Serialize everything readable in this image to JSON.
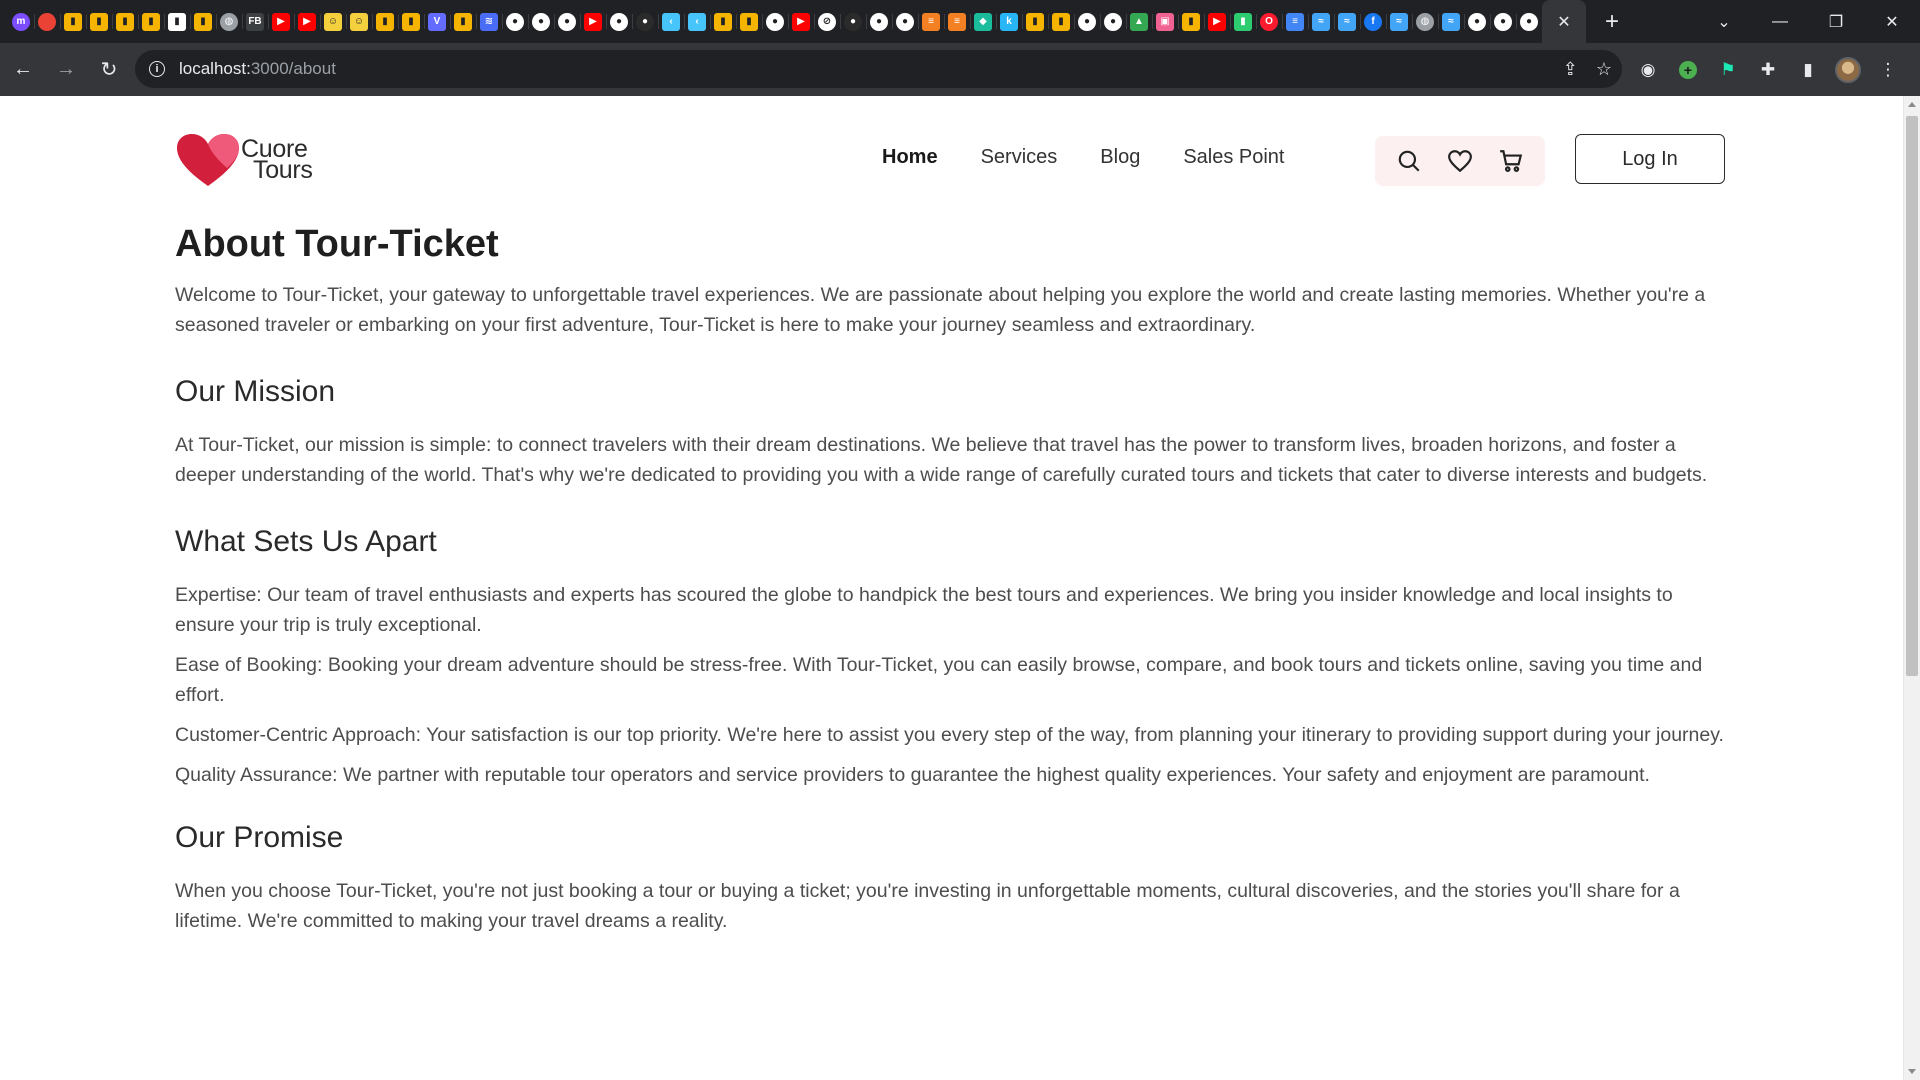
{
  "browser": {
    "url_host": "localhost:",
    "url_path": "3000/about",
    "tabs": [
      {
        "icon": "messenger-icon",
        "color": "#7b4dff",
        "glyph": "m",
        "circle": true
      },
      {
        "icon": "chrome-app-icon",
        "color": "#ea4335",
        "glyph": "",
        "circle": true
      },
      {
        "icon": "analytics-icon",
        "color": "#f4b400",
        "glyph": "▮"
      },
      {
        "icon": "analytics-icon",
        "color": "#f4b400",
        "glyph": "▮"
      },
      {
        "icon": "analytics-icon",
        "color": "#f4b400",
        "glyph": "▮"
      },
      {
        "icon": "analytics-icon",
        "color": "#f4b400",
        "glyph": "▮"
      },
      {
        "icon": "docs-icon",
        "color": "#ffffff",
        "glyph": "▮"
      },
      {
        "icon": "analytics-icon",
        "color": "#f4b400",
        "glyph": "▮"
      },
      {
        "icon": "globe-icon",
        "color": "#9aa0a6",
        "glyph": "◍",
        "circle": true
      },
      {
        "icon": "text-favicon-fb",
        "color": "#3c4043",
        "glyph": "FB"
      },
      {
        "icon": "youtube-icon",
        "color": "#ff0000",
        "glyph": "▶"
      },
      {
        "icon": "youtube-icon",
        "color": "#ff0000",
        "glyph": "▶"
      },
      {
        "icon": "emoji-icon",
        "color": "#f4d03f",
        "glyph": "☺"
      },
      {
        "icon": "emoji-icon",
        "color": "#f4d03f",
        "glyph": "☺"
      },
      {
        "icon": "analytics-icon",
        "color": "#f4b400",
        "glyph": "▮"
      },
      {
        "icon": "analytics-icon",
        "color": "#f4b400",
        "glyph": "▮"
      },
      {
        "icon": "vite-icon",
        "color": "#646cff",
        "glyph": "V"
      },
      {
        "icon": "analytics-icon",
        "color": "#f4b400",
        "glyph": "▮"
      },
      {
        "icon": "framer-icon",
        "color": "#4a6cf7",
        "glyph": "≋"
      },
      {
        "icon": "github-icon",
        "color": "#ffffff",
        "glyph": "●",
        "circle": true
      },
      {
        "icon": "github-icon",
        "color": "#ffffff",
        "glyph": "●",
        "circle": true
      },
      {
        "icon": "github-icon",
        "color": "#ffffff",
        "glyph": "●",
        "circle": true
      },
      {
        "icon": "youtube-icon",
        "color": "#ff0000",
        "glyph": "▶"
      },
      {
        "icon": "github-icon",
        "color": "#ffffff",
        "glyph": "●",
        "circle": true
      },
      {
        "icon": "dark-icon",
        "color": "#2b2b2b",
        "glyph": "●",
        "circle": true
      },
      {
        "icon": "flutter-icon",
        "color": "#47c5fb",
        "glyph": "‹"
      },
      {
        "icon": "flutter-icon",
        "color": "#47c5fb",
        "glyph": "‹"
      },
      {
        "icon": "analytics-icon",
        "color": "#f4b400",
        "glyph": "▮"
      },
      {
        "icon": "analytics-icon",
        "color": "#f4b400",
        "glyph": "▮"
      },
      {
        "icon": "github-icon",
        "color": "#ffffff",
        "glyph": "●",
        "circle": true
      },
      {
        "icon": "youtube-icon",
        "color": "#ff0000",
        "glyph": "▶"
      },
      {
        "icon": "link-icon",
        "color": "#ffffff",
        "glyph": "⊘",
        "circle": true
      },
      {
        "icon": "dark-icon",
        "color": "#2b2b2b",
        "glyph": "●",
        "circle": true
      },
      {
        "icon": "github-icon",
        "color": "#ffffff",
        "glyph": "●",
        "circle": true
      },
      {
        "icon": "github-icon",
        "color": "#ffffff",
        "glyph": "●",
        "circle": true
      },
      {
        "icon": "stackoverflow-icon",
        "color": "#f48024",
        "glyph": "≡"
      },
      {
        "icon": "stackoverflow-icon",
        "color": "#f48024",
        "glyph": "≡"
      },
      {
        "icon": "diamond-icon",
        "color": "#1abc9c",
        "glyph": "◆"
      },
      {
        "icon": "k-icon",
        "color": "#29b6f6",
        "glyph": "k"
      },
      {
        "icon": "analytics-icon",
        "color": "#f4b400",
        "glyph": "▮"
      },
      {
        "icon": "analytics-icon",
        "color": "#f4b400",
        "glyph": "▮"
      },
      {
        "icon": "github-icon",
        "color": "#ffffff",
        "glyph": "●",
        "circle": true
      },
      {
        "icon": "github-icon",
        "color": "#ffffff",
        "glyph": "●",
        "circle": true
      },
      {
        "icon": "drive-icon",
        "color": "#34a853",
        "glyph": "▲"
      },
      {
        "icon": "photo-icon",
        "color": "#f06292",
        "glyph": "▣"
      },
      {
        "icon": "analytics-icon",
        "color": "#f4b400",
        "glyph": "▮"
      },
      {
        "icon": "youtube-icon",
        "color": "#ff0000",
        "glyph": "▶"
      },
      {
        "icon": "bookmark-icon",
        "color": "#2ecc71",
        "glyph": "▮"
      },
      {
        "icon": "opera-icon",
        "color": "#ff1b2d",
        "glyph": "O",
        "circle": true
      },
      {
        "icon": "docs-icon",
        "color": "#4285f4",
        "glyph": "≡"
      },
      {
        "icon": "wave-icon",
        "color": "#42a5f5",
        "glyph": "≈"
      },
      {
        "icon": "wave-icon",
        "color": "#42a5f5",
        "glyph": "≈"
      },
      {
        "icon": "facebook-icon",
        "color": "#1877f2",
        "glyph": "f",
        "circle": true
      },
      {
        "icon": "wave-icon",
        "color": "#42a5f5",
        "glyph": "≈"
      },
      {
        "icon": "globe-icon",
        "color": "#9aa0a6",
        "glyph": "◍",
        "circle": true
      },
      {
        "icon": "wave-icon",
        "color": "#42a5f5",
        "glyph": "≈"
      },
      {
        "icon": "github-icon",
        "color": "#ffffff",
        "glyph": "●",
        "circle": true
      },
      {
        "icon": "github-icon",
        "color": "#ffffff",
        "glyph": "●",
        "circle": true
      },
      {
        "icon": "github-icon",
        "color": "#ffffff",
        "glyph": "●",
        "circle": true
      }
    ]
  },
  "site": {
    "logo_line1": "Cuore",
    "logo_line2": "Tours",
    "nav": [
      "Home",
      "Services",
      "Blog",
      "Sales Point"
    ],
    "active_nav": "Home",
    "login_label": "Log In",
    "accent_color": "#e8344e"
  },
  "page": {
    "title": "About Tour-Ticket",
    "intro": "Welcome to Tour-Ticket, your gateway to unforgettable travel experiences. We are passionate about helping you explore the world and create lasting memories. Whether you're a seasoned traveler or embarking on your first adventure, Tour-Ticket is here to make your journey seamless and extraordinary.",
    "mission_heading": "Our Mission",
    "mission_text": "At Tour-Ticket, our mission is simple: to connect travelers with their dream destinations. We believe that travel has the power to transform lives, broaden horizons, and foster a deeper understanding of the world. That's why we're dedicated to providing you with a wide range of carefully curated tours and tickets that cater to diverse interests and budgets.",
    "apart_heading": "What Sets Us Apart",
    "apart_items": [
      "Expertise: Our team of travel enthusiasts and experts has scoured the globe to handpick the best tours and experiences. We bring you insider knowledge and local insights to ensure your trip is truly exceptional.",
      "Ease of Booking: Booking your dream adventure should be stress-free. With Tour-Ticket, you can easily browse, compare, and book tours and tickets online, saving you time and effort.",
      "Customer-Centric Approach: Your satisfaction is our top priority. We're here to assist you every step of the way, from planning your itinerary to providing support during your journey.",
      "Quality Assurance: We partner with reputable tour operators and service providers to guarantee the highest quality experiences. Your safety and enjoyment are paramount."
    ],
    "promise_heading": "Our Promise",
    "promise_text": "When you choose Tour-Ticket, you're not just booking a tour or buying a ticket; you're investing in unforgettable moments, cultural discoveries, and the stories you'll share for a lifetime. We're committed to making your travel dreams a reality."
  }
}
